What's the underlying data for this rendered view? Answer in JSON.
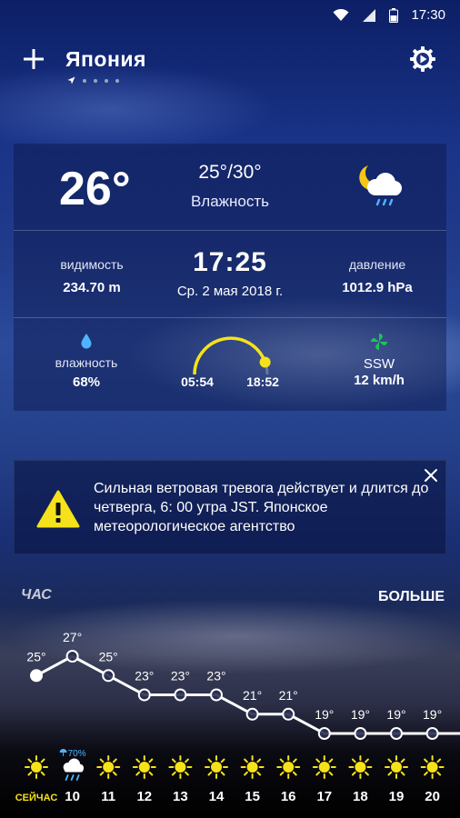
{
  "status_bar": {
    "time": "17:30"
  },
  "header": {
    "location": "Япония",
    "page_count": 5
  },
  "current": {
    "temp": "26°",
    "range": "25°/30°",
    "range_label": "Влажность",
    "time": "17:25",
    "date": "Ср. 2 мая 2018 г.",
    "visibility": {
      "label": "видимость",
      "value": "234.70 m"
    },
    "pressure": {
      "label": "давление",
      "value": "1012.9 hPa"
    },
    "humidity": {
      "label": "влажность",
      "value": "68%"
    },
    "sun": {
      "sunrise": "05:54",
      "sunset": "18:52",
      "day_progress": 0.89
    },
    "wind": {
      "direction": "SSW",
      "speed": "12 km/h"
    },
    "icon": "moon-cloud-rain-icon"
  },
  "alert": {
    "text": "Сильная ветровая тревога действует и длится до четверга, 6: 00 утра JST. Японское метеорологическое агентство",
    "icon": "warning-icon"
  },
  "hourly": {
    "title": "ЧАС",
    "more_label": "БОЛЬШЕ",
    "hours": [
      {
        "label": "СЕЙЧАС",
        "temp": 25,
        "temp_label": "25°",
        "icon": "sun-icon"
      },
      {
        "label": "10",
        "temp": 27,
        "temp_label": "27°",
        "icon": "cloud-rain-icon",
        "precip": "70%"
      },
      {
        "label": "11",
        "temp": 25,
        "temp_label": "25°",
        "icon": "sun-icon"
      },
      {
        "label": "12",
        "temp": 23,
        "temp_label": "23°",
        "icon": "sun-icon"
      },
      {
        "label": "13",
        "temp": 23,
        "temp_label": "23°",
        "icon": "sun-icon"
      },
      {
        "label": "14",
        "temp": 23,
        "temp_label": "23°",
        "icon": "sun-icon"
      },
      {
        "label": "15",
        "temp": 21,
        "temp_label": "21°",
        "icon": "sun-icon"
      },
      {
        "label": "16",
        "temp": 21,
        "temp_label": "21°",
        "icon": "sun-icon"
      },
      {
        "label": "17",
        "temp": 19,
        "temp_label": "19°",
        "icon": "sun-icon"
      },
      {
        "label": "18",
        "temp": 19,
        "temp_label": "19°",
        "icon": "sun-icon"
      },
      {
        "label": "19",
        "temp": 19,
        "temp_label": "19°",
        "icon": "sun-icon"
      },
      {
        "label": "20",
        "temp": 19,
        "temp_label": "19°",
        "icon": "sun-icon"
      }
    ]
  },
  "colors": {
    "accent_yellow": "#f5e21a",
    "wind_green": "#22c25a",
    "humidity_blue": "#4fb4ff",
    "now_label": "#f5e21a"
  }
}
